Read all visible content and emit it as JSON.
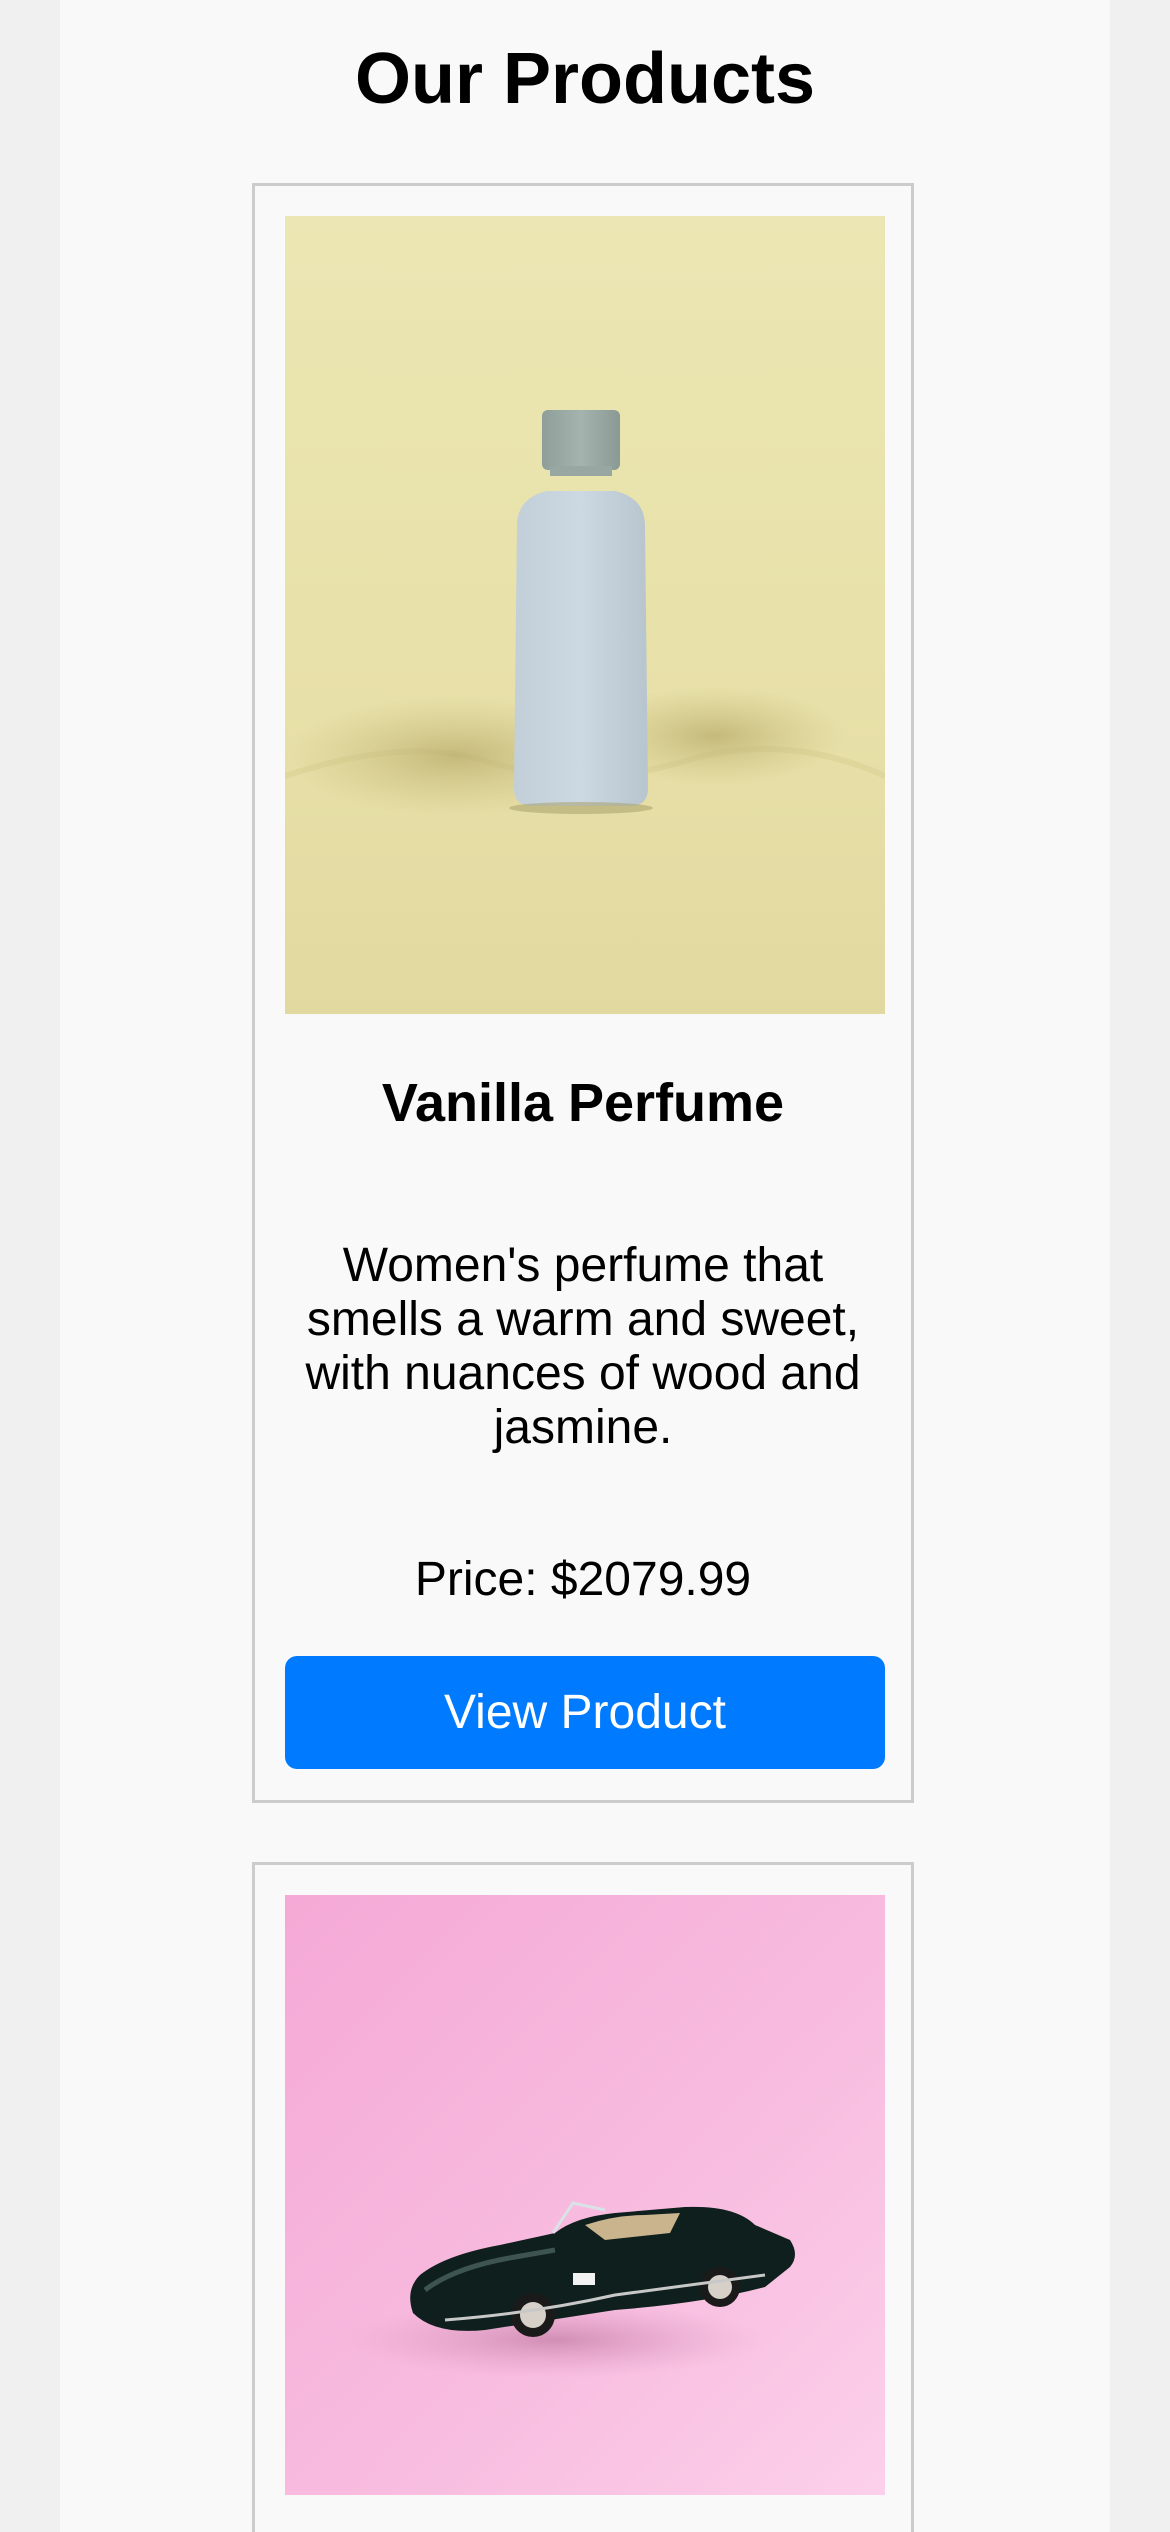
{
  "page": {
    "title": "Our Products"
  },
  "products": [
    {
      "name": "Vanilla Perfume",
      "description": "Women's perfume that smells a warm and sweet, with nuances of wood and jasmine.",
      "price": "Price: $2079.99",
      "button_label": "View Product",
      "image_icon": "perfume-bottle-image",
      "image_bg": "#e9e3b0"
    },
    {
      "image_icon": "toy-car-image",
      "image_bg": "#f7b8dd"
    }
  ],
  "colors": {
    "accent": "#007bff",
    "page_bg": "#f9f9f9",
    "outer_bg": "#f0f0f0",
    "card_border": "#cccccc"
  }
}
